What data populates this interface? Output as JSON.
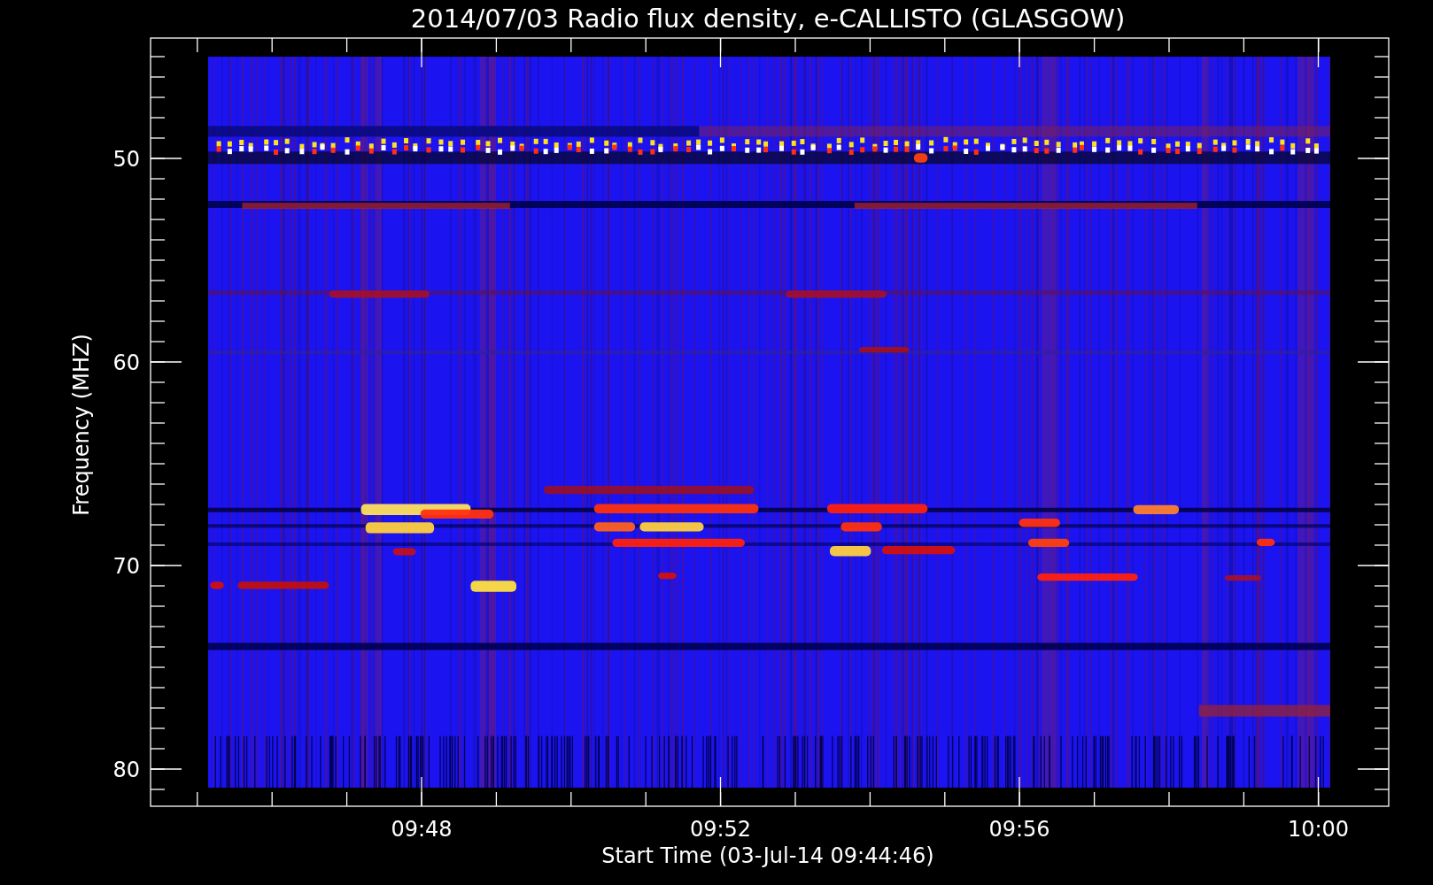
{
  "title": "2014/07/03  Radio flux density, e-CALLISTO (GLASGOW)",
  "y_axis": {
    "label": "Frequency (MHZ)",
    "tick_labels": [
      "50",
      "60",
      "70",
      "80"
    ]
  },
  "x_axis": {
    "label": "Start Time (03-Jul-14 09:44:46)",
    "tick_labels": [
      "09:48",
      "09:52",
      "09:56",
      "10:00"
    ]
  }
}
